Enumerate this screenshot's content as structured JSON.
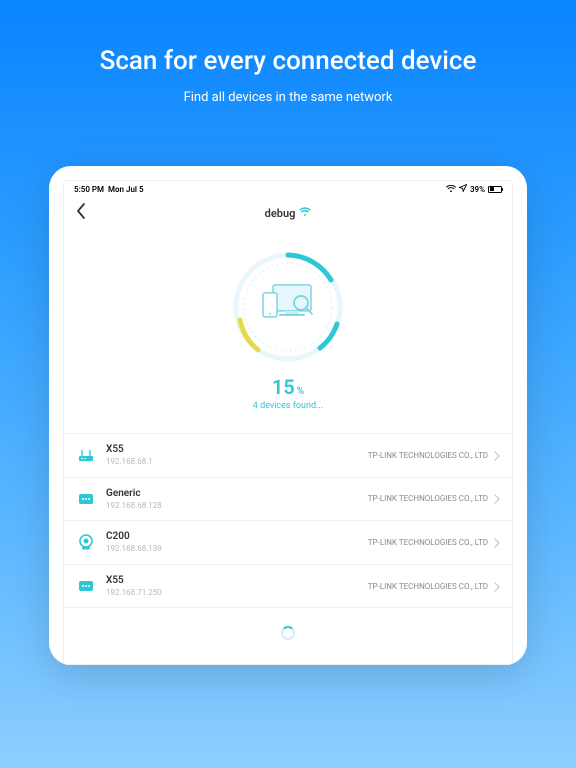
{
  "marketing": {
    "title": "Scan for every connected device",
    "subtitle": "Find all devices in the same network"
  },
  "status_bar": {
    "time": "5:50 PM",
    "date": "Mon Jul 5",
    "battery": "39%"
  },
  "nav": {
    "network_name": "debug"
  },
  "scan": {
    "percent": "15",
    "percent_unit": "%",
    "found_text": "4 devices found..."
  },
  "devices": [
    {
      "icon": "router",
      "name": "X55",
      "ip": "192.168.68.1",
      "vendor": "TP-LINK TECHNOLOGIES CO., LTD"
    },
    {
      "icon": "generic",
      "name": "Generic",
      "ip": "192.168.68.128",
      "vendor": "TP-LINK TECHNOLOGIES CO., LTD"
    },
    {
      "icon": "camera",
      "name": "C200",
      "ip": "192.168.68.139",
      "vendor": "TP-LINK TECHNOLOGIES CO., LTD"
    },
    {
      "icon": "generic",
      "name": "X55",
      "ip": "192.168.71.250",
      "vendor": "TP-LINK TECHNOLOGIES CO., LTD"
    }
  ]
}
